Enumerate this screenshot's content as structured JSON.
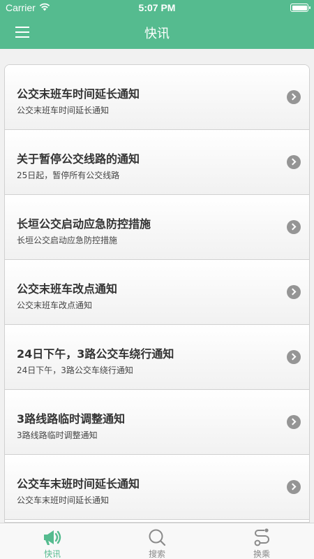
{
  "status_bar": {
    "carrier": "Carrier",
    "time": "5:07 PM"
  },
  "nav": {
    "title": "快讯"
  },
  "colors": {
    "accent": "#55bb8f"
  },
  "news": [
    {
      "title": "公交末班车时间延长通知",
      "subtitle": "公交末班车时间延长通知"
    },
    {
      "title": "关于暂停公交线路的通知",
      "subtitle": "25日起，暂停所有公交线路"
    },
    {
      "title": "长垣公交启动应急防控措施",
      "subtitle": "长垣公交启动应急防控措施"
    },
    {
      "title": "公交末班车改点通知",
      "subtitle": "公交末班车改点通知"
    },
    {
      "title": "24日下午，3路公交车绕行通知",
      "subtitle": "24日下午，3路公交车绕行通知"
    },
    {
      "title": "3路线路临时调整通知",
      "subtitle": "3路线路临时调整通知"
    },
    {
      "title": "公交车末班时间延长通知",
      "subtitle": "公交车末班时间延长通知"
    }
  ],
  "tabs": [
    {
      "label": "快讯",
      "icon": "megaphone-icon",
      "active": true
    },
    {
      "label": "搜索",
      "icon": "search-icon",
      "active": false
    },
    {
      "label": "换乘",
      "icon": "transfer-route-icon",
      "active": false
    }
  ]
}
